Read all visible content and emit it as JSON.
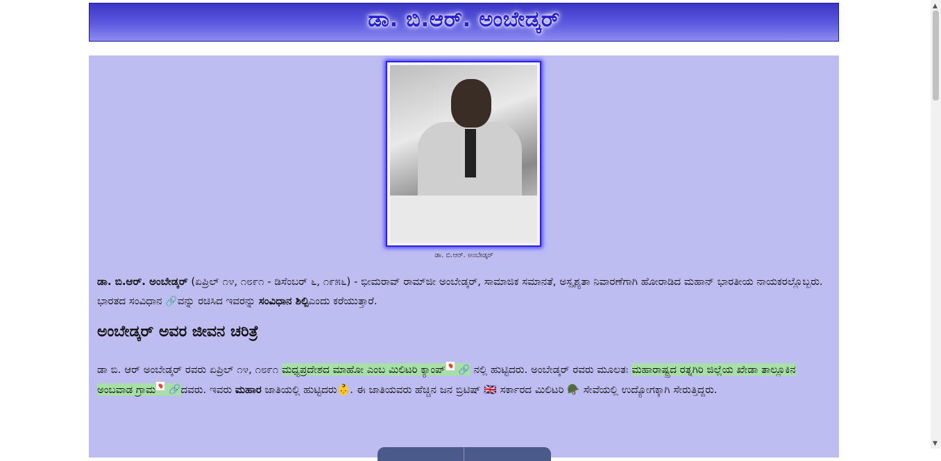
{
  "header": {
    "title": "ಡಾ. ಬಿ.ಆರ್. ಅಂಬೇಡ್ಕರ್"
  },
  "photo": {
    "caption": "ಡಾ. ಬಿ.ಆರ್. ಅಂಬೇಡ್ಕರ್"
  },
  "intro": {
    "name_bold": "ಡಾ. ಬಿ.ಆರ್. ಅಂಬೇಡ್ಕರ್",
    "text1": " (ಏಪ್ರಿಲ್ ೧೪, ೧೮೯೧ - ಡಿಸೆಂಬರ್ ೬, ೧೯೫೬) - ಭೀಮರಾವ್ ರಾಮ್‌ಜೀ ಅಂಬೇಡ್ಕರ್, ಸಾಮಾಜಿಕ ಸಮಾನತೆ, ಅಸ್ಪೃಶ್ಯತಾ ನಿವಾರಣೆಗಾಗಿ ಹೋರಾಡಿದ ಮಹಾನ್ ಭಾರತೀಯ ನಾಯಕರಲ್ಲೊಬ್ಬರು. ಭಾರತದ ಸಂವಿಧಾನ ",
    "text2": "ವನ್ನು ರಚಿಸಿದ ಇವರನ್ನು ",
    "bold2": "ಸಂವಿಧಾನ ಶಿಲ್ಪಿ",
    "text3": "ಎಂದು ಕರೆಯುತ್ತಾರೆ."
  },
  "section": {
    "heading": "ಅಂಬೇಡ್ಕರ್ ಅವರ ಜೀವನ ಚರಿತ್ರೆ"
  },
  "bio": {
    "text1": "ಡಾ ಬಿ. ಆರ್ ಅಂಬೇಡ್ಕರ್ ರವರು ಏಪ್ರಿಲ್ ೧೪, ೧೮೯೧ ",
    "link1": "ಮಧ್ಯಪ್ರದೇಶದ ಮಾಹೋ ಎಂಬ ಮಿಲಿಟರಿ ಕ್ಯಾಂಪ್",
    "text2": " ನಲ್ಲಿ ಹುಟ್ಟಿದರು. ಅಂಬೇಡ್ಕರ್ ರವರು ಮೂಲತಃ ",
    "link2": "ಮಹಾರಾಷ್ಟ್ರದ ರತ್ನಗಿರಿ ಜಿಲ್ಲೆಯ ಖೇಡಾ ತಾಲ್ಲೂಕಿನ ಅಂಬವಾಡ ಗ್ರಾಮ",
    "text3": "ದವರು. ಇವರು ",
    "bold": "ಮಹಾರ",
    "text4": " ಜಾತಿಯಲ್ಲಿ ಹುಟ್ಟಿದರು",
    "baby": "👶",
    "text5": ". ಈ ಜಾತಿಯವರು ಹೆಚ್ಚಿನ ಜನ ಬ್ರಿಟಿಷ್ ",
    "flag": "🇬🇧",
    "text6": " ಸರ್ಕಾರದ ಮಿಲಿಟರಿ ",
    "helmet": "🪖",
    "text7": " ಸೇವೆಯಲ್ಲಿ ಉದ್ಯೋಗಕ್ಕಾಗಿ ಸೇರುತ್ತಿದ್ದರು."
  },
  "icons": {
    "link": "🔗"
  }
}
